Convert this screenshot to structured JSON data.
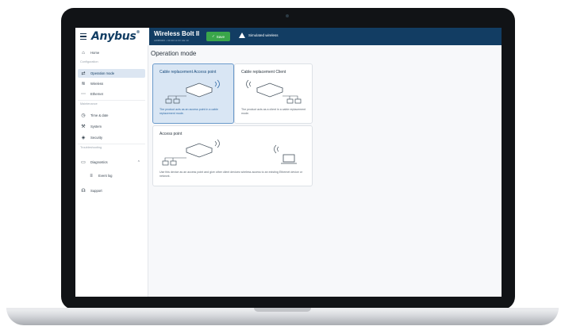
{
  "app": {
    "brand": "Anybus",
    "brand_mark": "®",
    "device_title": "Wireless Bolt II",
    "device_subtitle": "AWB5000 • 00:30:11:FF:AE:10",
    "save_label": "Save",
    "warning_text": "Simulated wireless"
  },
  "sidebar": {
    "sections": {
      "configuration": "Configuration",
      "maintenance": "Maintenance",
      "troubleshooting": "Troubleshooting"
    },
    "items": [
      {
        "label": "Home",
        "icon": "home-icon"
      },
      {
        "label": "Operation mode",
        "icon": "switch-icon"
      },
      {
        "label": "Wireless",
        "icon": "wifi-icon"
      },
      {
        "label": "Ethernet",
        "icon": "ethernet-icon"
      },
      {
        "label": "Time & date",
        "icon": "clock-icon"
      },
      {
        "label": "System",
        "icon": "system-icon"
      },
      {
        "label": "Security",
        "icon": "shield-icon"
      },
      {
        "label": "Diagnostics",
        "icon": "monitor-icon"
      },
      {
        "label": "Event log",
        "icon": "list-icon"
      },
      {
        "label": "Support",
        "icon": "headset-icon"
      }
    ]
  },
  "main": {
    "title": "Operation mode",
    "cards": [
      {
        "title": "Cable replacement Access point",
        "desc": "The product acts as an access point in a cable replacement mode.",
        "selected": true
      },
      {
        "title": "Cable replacement Client",
        "desc": "The product acts as a client in a cable replacement mode.",
        "selected": false
      },
      {
        "title": "Access point",
        "desc": "Use this device as an access point and give other client devices wireless access to an existing Ethernet device or network.",
        "selected": false
      }
    ]
  },
  "colors": {
    "header": "#123d63",
    "save_green": "#3aa64a",
    "selected_card": "#d9e6f4",
    "selected_border": "#6b9acb"
  }
}
